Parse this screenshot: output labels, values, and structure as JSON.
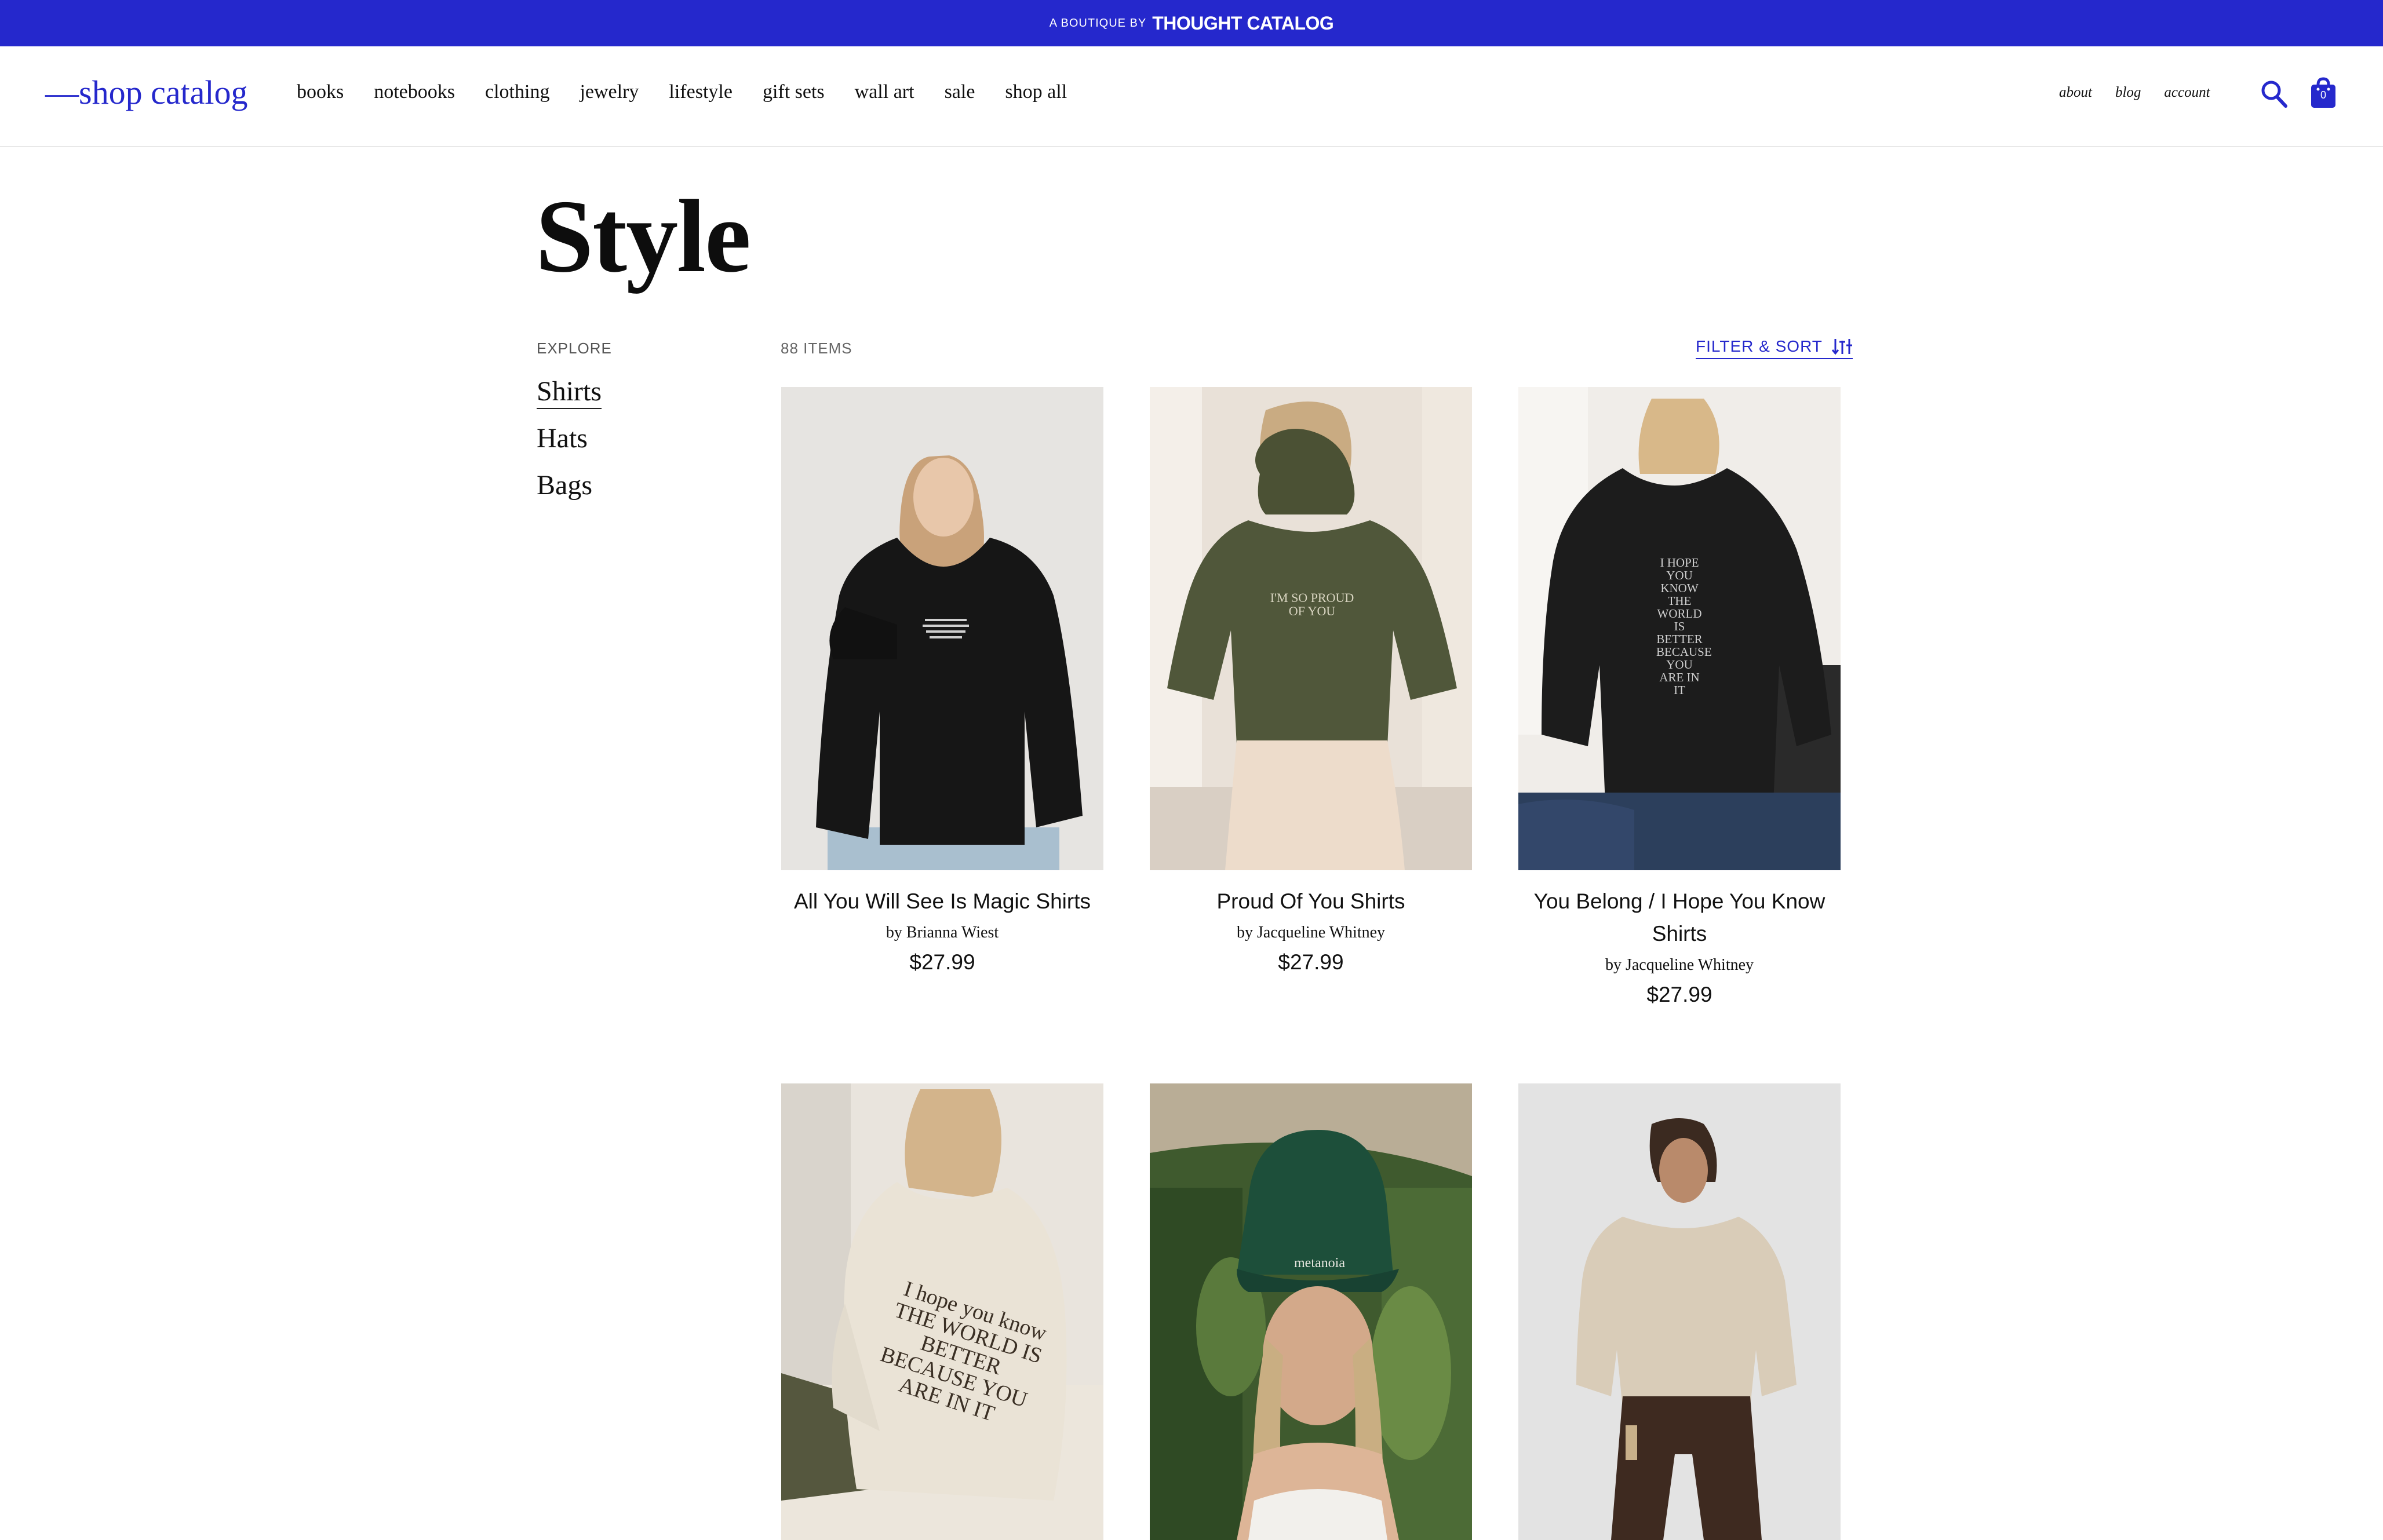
{
  "banner": {
    "prefix": "A BOUTIQUE BY",
    "brand": "THOUGHT CATALOG",
    "color": "#2528cc"
  },
  "header": {
    "logo": "—shop catalog",
    "nav": [
      "books",
      "notebooks",
      "clothing",
      "jewelry",
      "lifestyle",
      "gift sets",
      "wall art",
      "sale",
      "shop all"
    ],
    "utility": [
      "about",
      "blog",
      "account"
    ],
    "search_icon": "search-icon",
    "cart_icon": "shopping-bag-icon",
    "cart_count": "0"
  },
  "page": {
    "title": "Style"
  },
  "sidebar": {
    "label": "EXPLORE",
    "items": [
      "Shirts",
      "Hats",
      "Bags"
    ],
    "active": "Shirts"
  },
  "toolbar": {
    "items_count": "88 ITEMS",
    "filter_label": "FILTER & SORT",
    "filter_icon": "sort-icon"
  },
  "products": [
    {
      "name": "All You Will See Is Magic Shirts",
      "author": "by Brianna Wiest",
      "price": "$27.99",
      "image": "model-black-hoodie-front"
    },
    {
      "name": "Proud Of You Shirts",
      "author": "by Jacqueline Whitney",
      "price": "$27.99",
      "image": "model-olive-hoodie-back",
      "print": "I'M SO PROUD OF YOU"
    },
    {
      "name": "You Belong / I Hope You Know Shirts",
      "author": "by Jacqueline Whitney",
      "price": "$27.99",
      "image": "model-black-sweatshirt-back",
      "print": "I HOPE YOU KNOW THE WORLD IS BETTER BECAUSE YOU ARE IN IT"
    },
    {
      "image": "model-cream-sweatshirt-back",
      "print": "I hope you know THE WORLD IS BETTER BECAUSE YOU ARE IN IT"
    },
    {
      "image": "green-metanoia-cap",
      "print": "metanoia"
    },
    {
      "image": "model-sand-hoodie-front"
    }
  ],
  "colors": {
    "accent": "#2528cc",
    "text": "#111111",
    "muted": "#666666"
  }
}
